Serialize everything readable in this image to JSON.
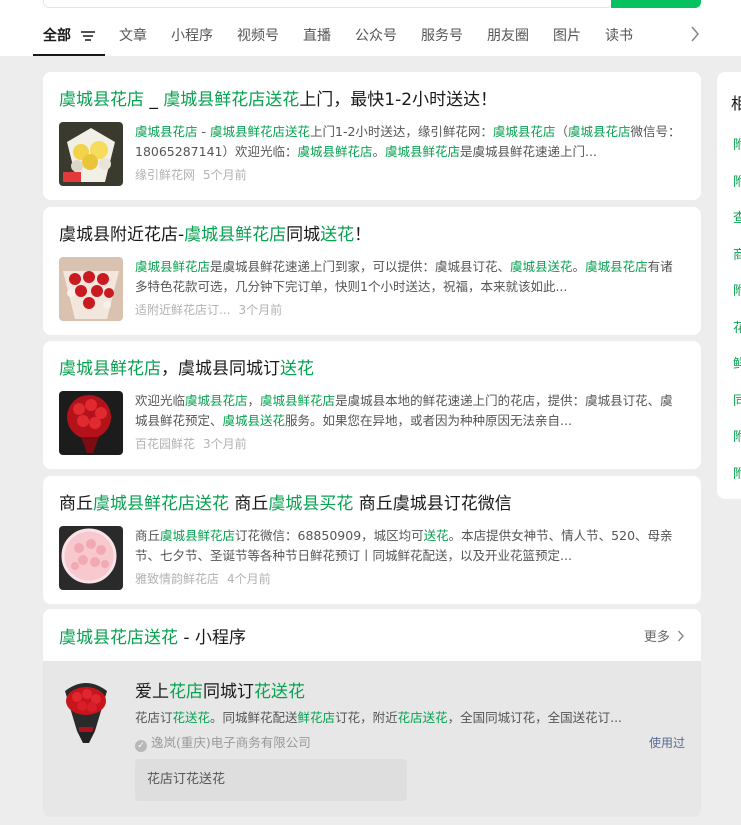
{
  "tabs": [
    {
      "label": "全部"
    },
    {
      "label": "文章"
    },
    {
      "label": "小程序"
    },
    {
      "label": "视频号"
    },
    {
      "label": "直播"
    },
    {
      "label": "公众号"
    },
    {
      "label": "服务号"
    },
    {
      "label": "朋友圈"
    },
    {
      "label": "图片"
    },
    {
      "label": "读书"
    }
  ],
  "results": [
    {
      "title_parts": [
        {
          "t": "虞城县花店",
          "hl": true
        },
        {
          "t": " _ ",
          "hl": false
        },
        {
          "t": "虞城县鲜花店送花",
          "hl": true
        },
        {
          "t": "上门，最快1-2小时送达！",
          "hl": false
        }
      ],
      "desc_parts": [
        {
          "t": "虞城县花店",
          "hl": true
        },
        {
          "t": " - ",
          "hl": false
        },
        {
          "t": "虞城县鲜花店送花",
          "hl": true
        },
        {
          "t": "上门1-2小时送达，缘引鲜花网：",
          "hl": false
        },
        {
          "t": "虞城县花店",
          "hl": true
        },
        {
          "t": "（",
          "hl": false
        },
        {
          "t": "虞城县花店",
          "hl": true
        },
        {
          "t": "微信号：18065287141）欢迎光临：",
          "hl": false
        },
        {
          "t": "虞城县鲜花店",
          "hl": true
        },
        {
          "t": "。",
          "hl": false
        },
        {
          "t": "虞城县鲜花店",
          "hl": true
        },
        {
          "t": "是虞城县鲜花速递上门...",
          "hl": false
        }
      ],
      "source": "缘引鲜花网",
      "time": "5个月前"
    },
    {
      "title_parts": [
        {
          "t": "虞城县附近花店-",
          "hl": false
        },
        {
          "t": "虞城县鲜花店",
          "hl": true
        },
        {
          "t": "同城",
          "hl": false
        },
        {
          "t": "送花",
          "hl": true
        },
        {
          "t": "！",
          "hl": false
        }
      ],
      "desc_parts": [
        {
          "t": "虞城县鲜花店",
          "hl": true
        },
        {
          "t": "是虞城县鲜花速递上门到家，可以提供：虞城县订花、",
          "hl": false
        },
        {
          "t": "虞城县送花",
          "hl": true
        },
        {
          "t": "。",
          "hl": false
        },
        {
          "t": "虞城县花店",
          "hl": true
        },
        {
          "t": "有诸多特色花款可选，几分钟下完订单，快则1个小时送达，祝福，本来就该如此...",
          "hl": false
        }
      ],
      "source": "适附近鲜花店订...",
      "time": "3个月前"
    },
    {
      "title_parts": [
        {
          "t": "虞城县鲜花店",
          "hl": true
        },
        {
          "t": "，虞城县同城订",
          "hl": false
        },
        {
          "t": "送花",
          "hl": true
        }
      ],
      "desc_parts": [
        {
          "t": "欢迎光临",
          "hl": false
        },
        {
          "t": "虞城县花店",
          "hl": true
        },
        {
          "t": "，",
          "hl": false
        },
        {
          "t": "虞城县鲜花店",
          "hl": true
        },
        {
          "t": "是虞城县本地的鲜花速递上门的花店，提供：虞城县订花、虞城县鲜花预定、",
          "hl": false
        },
        {
          "t": "虞城县送花",
          "hl": true
        },
        {
          "t": "服务。如果您在异地，或者因为种种原因无法亲自...",
          "hl": false
        }
      ],
      "source": "百花园鲜花",
      "time": "3个月前"
    },
    {
      "title_parts": [
        {
          "t": "商丘",
          "hl": false
        },
        {
          "t": "虞城县鲜花店送花",
          "hl": true
        },
        {
          "t": " 商丘",
          "hl": false
        },
        {
          "t": "虞城县买花",
          "hl": true
        },
        {
          "t": " 商丘虞城县订花微信",
          "hl": false
        }
      ],
      "desc_parts": [
        {
          "t": "商丘",
          "hl": false
        },
        {
          "t": "虞城县鲜花店",
          "hl": true
        },
        {
          "t": "订花微信：68850909，城区均可",
          "hl": false
        },
        {
          "t": "送花",
          "hl": true
        },
        {
          "t": "。本店提供女神节、情人节、520、母亲节、七夕节、圣诞节等各种节日鲜花预订丨同城鲜花配送，以及开业花篮预定...",
          "hl": false
        }
      ],
      "source": "雅致情韵鲜花店",
      "time": "4个月前"
    }
  ],
  "miniprogram": {
    "header_parts": [
      {
        "t": "虞城县花店送花",
        "hl": true
      },
      {
        "t": " - 小程序",
        "hl": false
      }
    ],
    "more_label": "更多",
    "name_parts": [
      {
        "t": "爱上",
        "hl": false
      },
      {
        "t": "花店",
        "hl": true
      },
      {
        "t": "同城订",
        "hl": false
      },
      {
        "t": "花送花",
        "hl": true
      }
    ],
    "desc_parts": [
      {
        "t": "花店订",
        "hl": false
      },
      {
        "t": "花送花",
        "hl": true
      },
      {
        "t": "。同城鲜花配送",
        "hl": false
      },
      {
        "t": "鲜花店",
        "hl": true
      },
      {
        "t": "订花，附近",
        "hl": false
      },
      {
        "t": "花店送花",
        "hl": true
      },
      {
        "t": "，全国同城订花，全国送花订...",
        "hl": false
      }
    ],
    "company": "逸岚(重庆)电子商务有限公司",
    "used_label": "使用过",
    "tag": "花店订花送花"
  },
  "side_panel": {
    "title": "相",
    "items": [
      "附",
      "附",
      "查",
      "商",
      "附",
      "花",
      "鲜",
      "同",
      "附",
      "附"
    ]
  },
  "colors": {
    "highlight": "#07a250",
    "brand": "#07c160",
    "link": "#576b95"
  }
}
